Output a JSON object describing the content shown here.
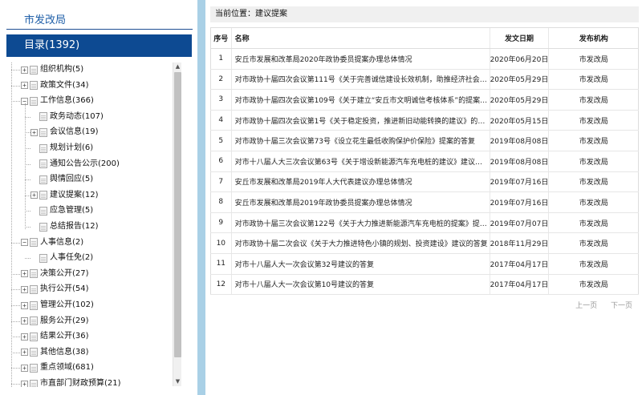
{
  "left": {
    "dept_title": "市发改局",
    "directory_label": "目录(1392)",
    "tree": [
      {
        "label": "组织机构(5)",
        "level": 0,
        "expander": "+"
      },
      {
        "label": "政策文件(34)",
        "level": 0,
        "expander": "+"
      },
      {
        "label": "工作信息(366)",
        "level": 0,
        "expander": "-"
      },
      {
        "label": "政务动态(107)",
        "level": 1,
        "expander": ""
      },
      {
        "label": "会议信息(19)",
        "level": 1,
        "expander": "+"
      },
      {
        "label": "规划计划(6)",
        "level": 1,
        "expander": ""
      },
      {
        "label": "通知公告公示(200)",
        "level": 1,
        "expander": ""
      },
      {
        "label": "舆情回应(5)",
        "level": 1,
        "expander": ""
      },
      {
        "label": "建议提案(12)",
        "level": 1,
        "expander": "+"
      },
      {
        "label": "应急管理(5)",
        "level": 1,
        "expander": ""
      },
      {
        "label": "总结报告(12)",
        "level": 1,
        "expander": ""
      },
      {
        "label": "人事信息(2)",
        "level": 0,
        "expander": "-"
      },
      {
        "label": "人事任免(2)",
        "level": 1,
        "expander": ""
      },
      {
        "label": "决策公开(27)",
        "level": 0,
        "expander": "+"
      },
      {
        "label": "执行公开(54)",
        "level": 0,
        "expander": "+"
      },
      {
        "label": "管理公开(102)",
        "level": 0,
        "expander": "+"
      },
      {
        "label": "服务公开(29)",
        "level": 0,
        "expander": "+"
      },
      {
        "label": "结果公开(36)",
        "level": 0,
        "expander": "+"
      },
      {
        "label": "其他信息(38)",
        "level": 0,
        "expander": "+"
      },
      {
        "label": "重点领域(681)",
        "level": 0,
        "expander": "+"
      },
      {
        "label": "市直部门财政预算(21)",
        "level": 0,
        "expander": "+"
      }
    ]
  },
  "right": {
    "breadcrumb": "当前位置：建议提案",
    "columns": {
      "no": "序号",
      "name": "名称",
      "date": "发文日期",
      "org": "发布机构"
    },
    "rows": [
      {
        "no": "1",
        "name": "安丘市发展和改革局2020年政协委员提案办理总体情况",
        "date": "2020年06月20日",
        "org": "市发改局"
      },
      {
        "no": "2",
        "name": "对市政协十届四次会议第111号《关于完善诚信建设长效机制，助推经济社会高...",
        "date": "2020年05月29日",
        "org": "市发改局"
      },
      {
        "no": "3",
        "name": "对市政协十届四次会议第109号《关于建立“安丘市文明诚信考核体系”的提案》...",
        "date": "2020年05月29日",
        "org": "市发改局"
      },
      {
        "no": "4",
        "name": "对市政协十届四次会议第1号《关于稳定投资，推进新旧动能转换的建议》的提...",
        "date": "2020年05月15日",
        "org": "市发改局"
      },
      {
        "no": "5",
        "name": "对市政协十届三次会议第73号《设立花生最低收购保护价保险》提案的答复",
        "date": "2019年08月08日",
        "org": "市发改局"
      },
      {
        "no": "6",
        "name": "对市十八届人大三次会议第63号《关于增设新能源汽车充电桩的建议》建议的答复",
        "date": "2019年08月08日",
        "org": "市发改局"
      },
      {
        "no": "7",
        "name": "安丘市发展和改革局2019年人大代表建议办理总体情况",
        "date": "2019年07月16日",
        "org": "市发改局"
      },
      {
        "no": "8",
        "name": "安丘市发展和改革局2019年政协委员提案办理总体情况",
        "date": "2019年07月16日",
        "org": "市发改局"
      },
      {
        "no": "9",
        "name": "对市政协十届三次会议第122号《关于大力推进新能源汽车充电桩的提案》提案的答复",
        "date": "2019年07月07日",
        "org": "市发改局"
      },
      {
        "no": "10",
        "name": "对市政协十届二次会议《关于大力推进特色小镇的规划、投资建设》建议的答复",
        "date": "2018年11月29日",
        "org": "市发改局"
      },
      {
        "no": "11",
        "name": "对市十八届人大一次会议第32号建议的答复",
        "date": "2017年04月17日",
        "org": "市发改局"
      },
      {
        "no": "12",
        "name": "对市十八届人大一次会议第10号建议的答复",
        "date": "2017年04月17日",
        "org": "市发改局"
      }
    ],
    "pager": {
      "prev": "上一页",
      "next": "下一页"
    }
  },
  "colors": {
    "primary": "#0d4a92",
    "divider": "#a9d0e6",
    "title_text": "#1f5fa8"
  }
}
